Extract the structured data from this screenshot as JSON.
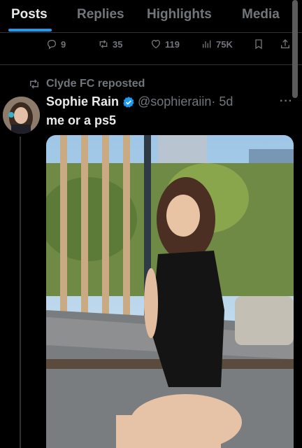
{
  "tabs": [
    {
      "label": "Posts",
      "active": true
    },
    {
      "label": "Replies",
      "active": false
    },
    {
      "label": "Highlights",
      "active": false
    },
    {
      "label": "Media",
      "active": false
    }
  ],
  "prev_post_actions": {
    "replies": "9",
    "reposts": "35",
    "likes": "119",
    "views": "75K"
  },
  "post": {
    "repost_text": "Clyde FC reposted",
    "display_name": "Sophie Rain",
    "handle": "@sophieraiin",
    "time": "· 5d",
    "text": "me or a ps5",
    "more": "···"
  },
  "icons": [
    "reply-icon",
    "repost-icon",
    "like-icon",
    "views-icon",
    "bookmark-icon",
    "share-icon",
    "verified-badge-icon"
  ],
  "colors": {
    "accent": "#1d9bf0",
    "muted": "#71767b",
    "text": "#e7e9ea",
    "background": "#000000"
  }
}
